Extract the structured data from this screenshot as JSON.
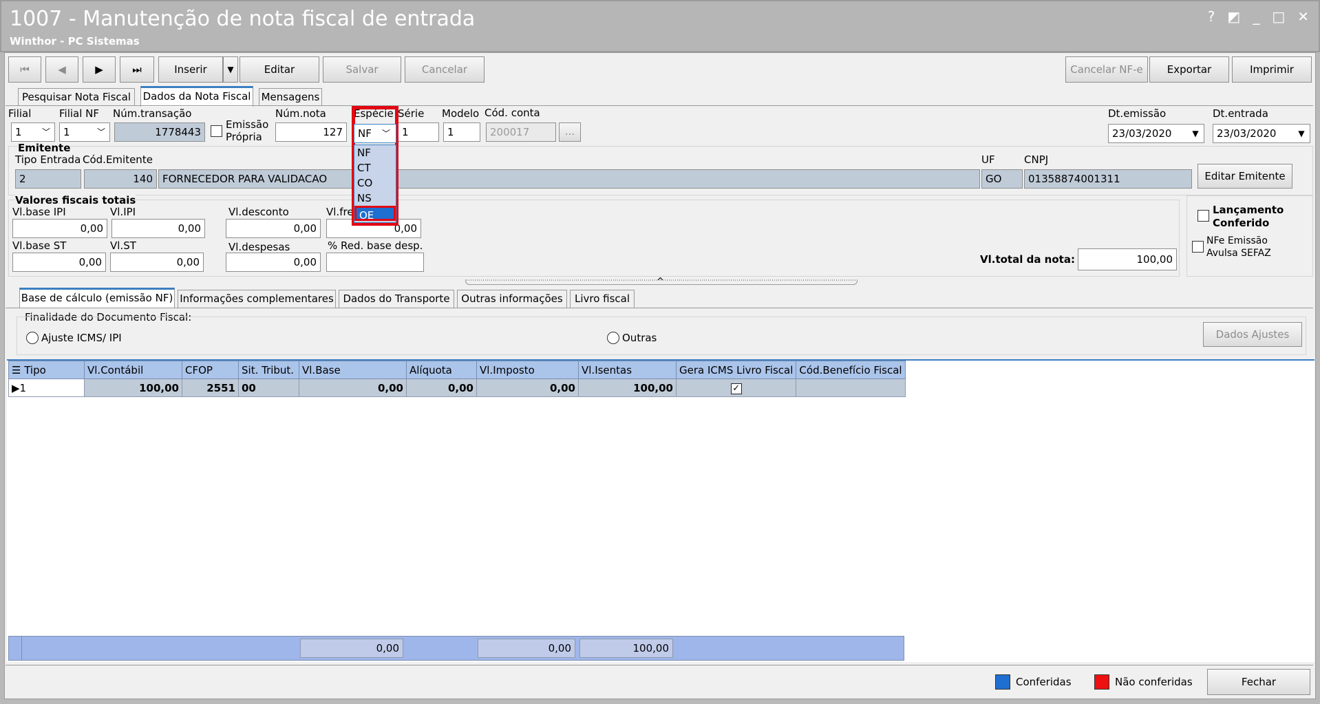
{
  "window": {
    "title": "1007 - Manutenção de nota fiscal de entrada",
    "subtitle": "Winthor - PC Sistemas",
    "controls": [
      "?",
      "◩",
      "_",
      "□",
      "✕"
    ]
  },
  "toolbar": {
    "first": "⏮",
    "prev": "◀",
    "next": "▶",
    "last": "⏭",
    "inserir": "Inserir",
    "editar": "Editar",
    "salvar": "Salvar",
    "cancelar": "Cancelar",
    "cancelar_nfe": "Cancelar NF-e",
    "exportar": "Exportar",
    "imprimir": "Imprimir"
  },
  "tabs": [
    "Pesquisar Nota Fiscal",
    "Dados da Nota Fiscal",
    "Mensagens"
  ],
  "header": {
    "filial_label": "Filial",
    "filial_value": "1",
    "filial_nf_label": "Filial NF",
    "filial_nf_value": "1",
    "num_transacao_label": "Núm.transação",
    "num_transacao_value": "1778443",
    "emissao_propria_line1": "Emissão",
    "emissao_propria_line2": "Própria",
    "num_nota_label": "Núm.nota",
    "num_nota_value": "127",
    "especie_label": "Espécie",
    "especie_value": "NF",
    "especie_options": [
      "NF",
      "CT",
      "CO",
      "NS",
      "OE"
    ],
    "especie_highlighted": "OE",
    "serie_label": "Série",
    "serie_value": "1",
    "modelo_label": "Modelo",
    "modelo_value": "1",
    "cod_conta_label": "Cód. conta",
    "cod_conta_value": "200017",
    "cod_conta_btn": "...",
    "dt_emissao_label": "Dt.emissão",
    "dt_emissao_value": "23/03/2020",
    "dt_entrada_label": "Dt.entrada",
    "dt_entrada_value": "23/03/2020"
  },
  "emitente": {
    "section": "Emitente",
    "tipo_entrada_label": "Tipo Entrada",
    "tipo_entrada_value": "2",
    "cod_emitente_label": "Cód.Emitente",
    "cod_emitente_value": "140",
    "nome_value": "FORNECEDOR PARA VALIDACAO",
    "uf_label": "UF",
    "uf_value": "GO",
    "cnpj_label": "CNPJ",
    "cnpj_value": "01358874001311",
    "editar_btn": "Editar Emitente"
  },
  "valores": {
    "section": "Valores fiscais totais",
    "vl_base_ipi_label": "Vl.base IPI",
    "vl_base_ipi": "0,00",
    "vl_ipi_label": "Vl.IPI",
    "vl_ipi": "0,00",
    "vl_desconto_label": "Vl.desconto",
    "vl_desconto": "0,00",
    "vl_frete_label": "Vl.fre",
    "vl_frete": "0,00",
    "vl_base_st_label": "Vl.base ST",
    "vl_base_st": "0,00",
    "vl_st_label": "Vl.ST",
    "vl_st": "0,00",
    "vl_despesas_label": "Vl.despesas",
    "vl_despesas": "0,00",
    "red_base_label": "% Red. base desp.",
    "red_base": "",
    "vl_total_label": "Vl.total da nota:",
    "vl_total": "100,00",
    "lancamento_line1": "Lançamento",
    "lancamento_line2": "Conferido",
    "nfe_line1": "NFe Emissão",
    "nfe_line2": "Avulsa SEFAZ"
  },
  "subtabs": [
    "Base de cálculo (emissão NF)",
    "Informações complementares",
    "Dados do Transporte",
    "Outras informações",
    "Livro fiscal"
  ],
  "finalidade": {
    "label": "Finalidade do Documento Fiscal:",
    "ajuste": "Ajuste ICMS/ IPI",
    "outras": "Outras",
    "dados_ajustes": "Dados Ajustes"
  },
  "grid": {
    "columns": [
      "Tipo",
      "Vl.Contábil",
      "CFOP",
      "Sit. Tribut.",
      "Vl.Base",
      "Alíquota",
      "Vl.Imposto",
      "Vl.Isentas",
      "Gera ICMS Livro Fiscal",
      "Cód.Benefício Fiscal"
    ],
    "row": {
      "tipo": "1",
      "vl_contabil": "100,00",
      "cfop": "2551",
      "sit_tribut": "00",
      "vl_base": "0,00",
      "aliquota": "0,00",
      "vl_imposto": "0,00",
      "vl_isentas": "100,00",
      "gera_icms": true,
      "cod_beneficio": ""
    },
    "totals": {
      "vl_base": "0,00",
      "vl_imposto": "0,00",
      "vl_isentas": "100,00"
    }
  },
  "footer": {
    "conferidas": "Conferidas",
    "nao_conferidas": "Não conferidas",
    "fechar": "Fechar",
    "conferidas_color": "#1f6fd0",
    "nao_conferidas_color": "#ee1111"
  },
  "colors": {
    "highlight": "#e30613",
    "selected": "#1f6fd0",
    "grid_header": "#abc4ea"
  }
}
